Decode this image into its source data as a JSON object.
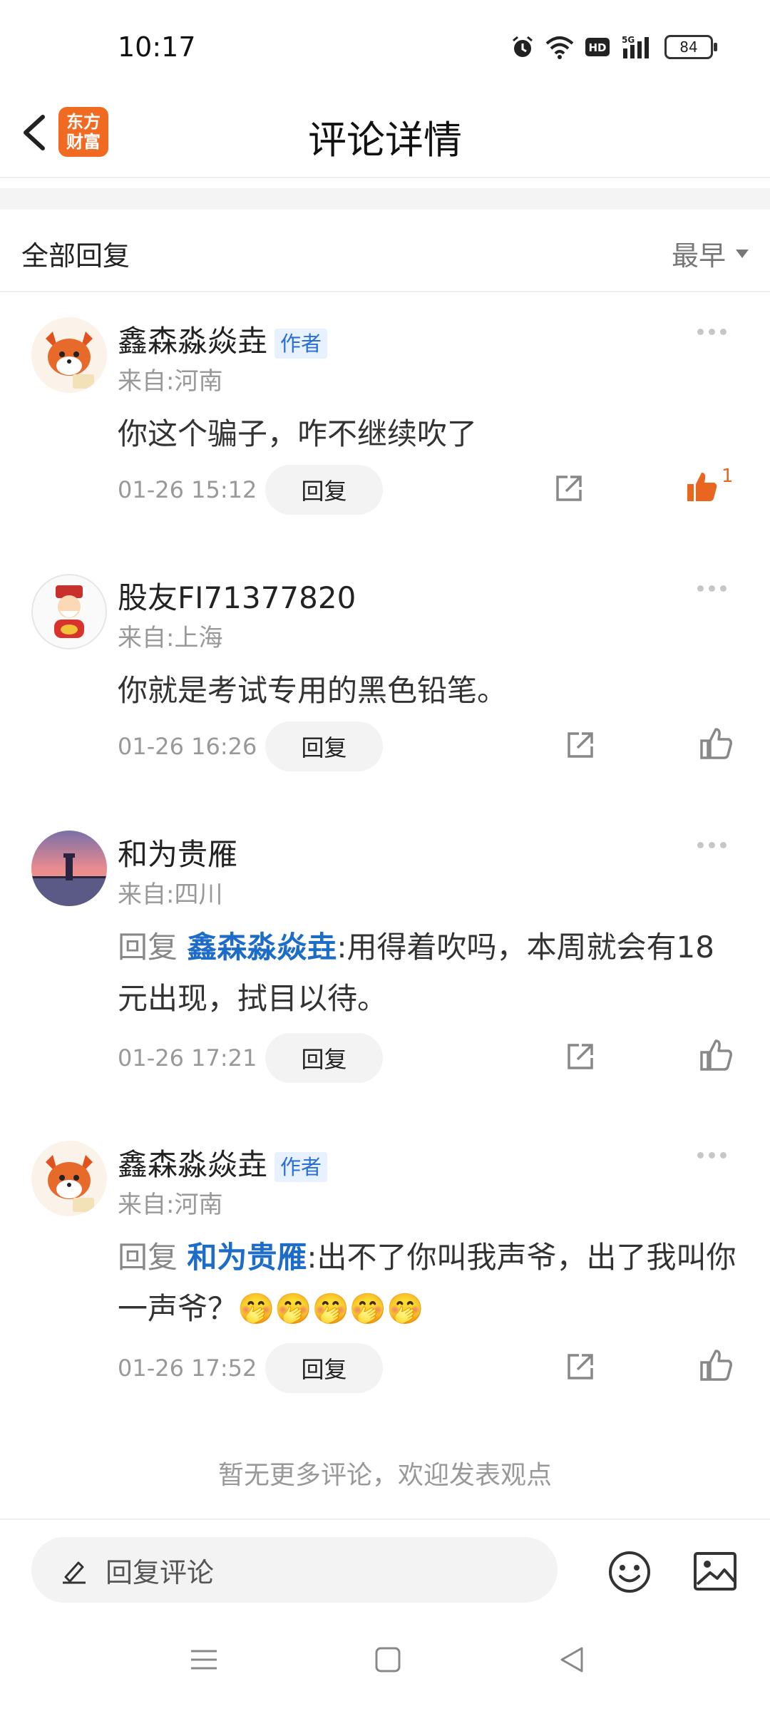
{
  "status_bar": {
    "time": "10:17",
    "battery": "84",
    "network": "5G"
  },
  "header": {
    "title": "评论详情",
    "logo_line1": "东方",
    "logo_line2": "财富"
  },
  "section": {
    "title": "全部回复",
    "sort_label": "最早"
  },
  "comments": [
    {
      "name": "鑫森淼焱垚",
      "badge": "作者",
      "location": "来自:河南",
      "reply_prefix": "",
      "reply_target": "",
      "text": "你这个骗子，咋不继续吹了",
      "time": "01-26 15:12",
      "reply_label": "回复",
      "likes": "1",
      "liked": true
    },
    {
      "name": "股友FI71377820",
      "badge": "",
      "location": "来自:上海",
      "reply_prefix": "",
      "reply_target": "",
      "text": "你就是考试专用的黑色铅笔。",
      "time": "01-26 16:26",
      "reply_label": "回复",
      "likes": "",
      "liked": false
    },
    {
      "name": "和为贵雁",
      "badge": "",
      "location": "来自:四川",
      "reply_prefix": "回复 ",
      "reply_target": "鑫森淼焱垚",
      "text": ":用得着吹吗，本周就会有18元出现，拭目以待。",
      "time": "01-26 17:21",
      "reply_label": "回复",
      "likes": "",
      "liked": false
    },
    {
      "name": "鑫森淼焱垚",
      "badge": "作者",
      "location": "来自:河南",
      "reply_prefix": "回复 ",
      "reply_target": "和为贵雁",
      "text": ":出不了你叫我声爷，出了我叫你一声爷？🤭🤭🤭🤭🤭",
      "time": "01-26 17:52",
      "reply_label": "回复",
      "likes": "",
      "liked": false
    }
  ],
  "no_more": "暂无更多评论，欢迎发表观点",
  "bottom": {
    "input_placeholder": "回复评论"
  },
  "colors": {
    "accent": "#f06a22",
    "link": "#1d6cc7",
    "like_active": "#e8661e"
  }
}
